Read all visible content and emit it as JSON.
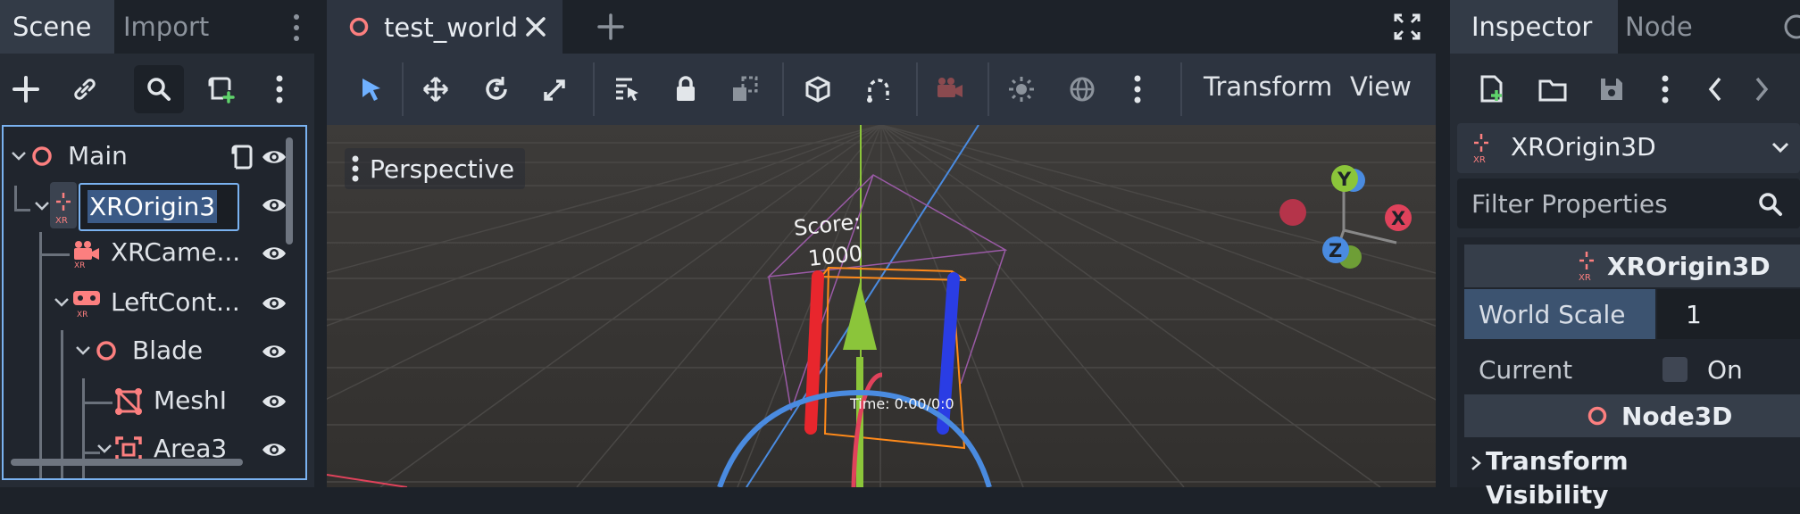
{
  "scene_dock": {
    "tabs": [
      {
        "label": "Scene"
      },
      {
        "label": "Import"
      }
    ],
    "tree": [
      {
        "label": "Main"
      },
      {
        "label": "XROrigin3"
      },
      {
        "label": "XRCame..."
      },
      {
        "label": "LeftCont..."
      },
      {
        "label": "Blade"
      },
      {
        "label": "MeshI"
      },
      {
        "label": "Area3"
      }
    ]
  },
  "editor": {
    "tab_title": "test_world",
    "menus": {
      "transform": "Transform",
      "view": "View"
    },
    "viewport": {
      "perspective_label": "Perspective",
      "score_text": "Score:",
      "score_value": "1000",
      "time_text": "Time: 0:00/0:0",
      "gizmo": {
        "y": "Y",
        "x": "X",
        "z": "Z"
      }
    }
  },
  "inspector": {
    "tabs": [
      {
        "label": "Inspector"
      },
      {
        "label": "Node"
      }
    ],
    "selected_node": "XROrigin3D",
    "filter_placeholder": "Filter Properties",
    "section_xr": "XROrigin3D",
    "properties": {
      "world_scale": {
        "label": "World Scale",
        "value": "1"
      },
      "current": {
        "label": "Current",
        "value": "On"
      }
    },
    "section_node3d": "Node3D",
    "groups": {
      "transform": "Transform",
      "visibility": "Visibility"
    }
  },
  "colors": {
    "accent": "#7ab2f0",
    "node_red": "#fc7f7f",
    "selected": "#3b5a86",
    "gizmo_x": "#e0425b",
    "gizmo_y": "#8bc53a",
    "gizmo_z": "#4a8be0"
  }
}
